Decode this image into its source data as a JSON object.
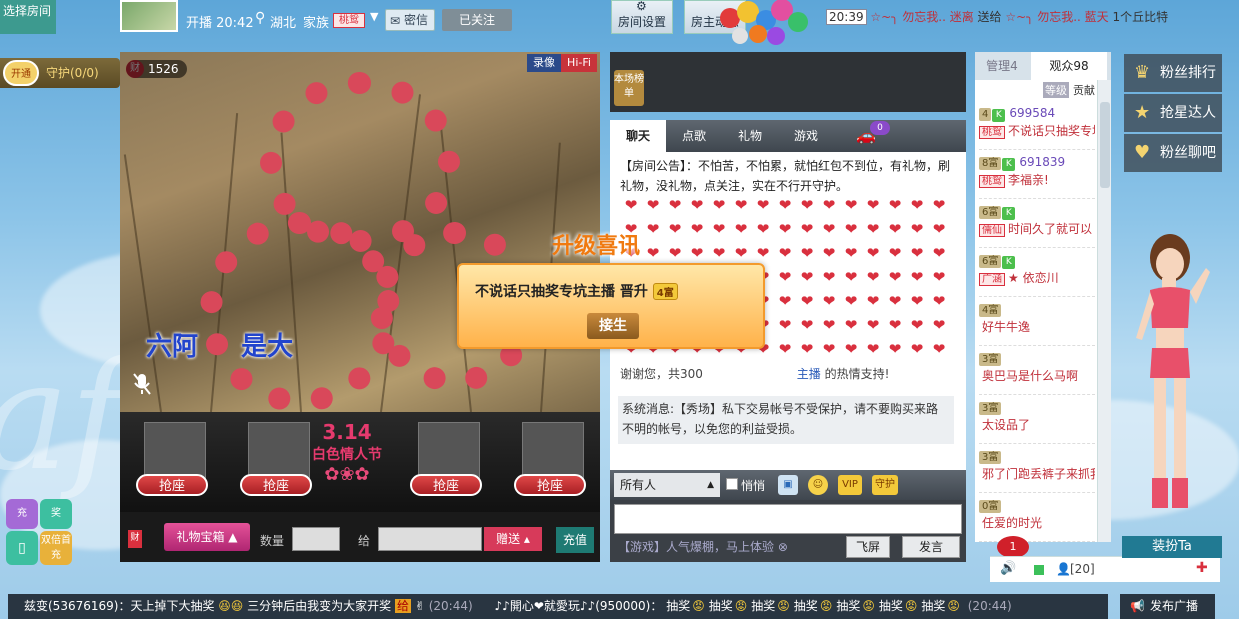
{
  "window": {
    "select_room": "选择房间"
  },
  "anchor": {
    "time_text": "开播 20:42",
    "location": "湖北",
    "family_label": "家族",
    "family_badge": "桃鸳",
    "pm_label": "密信",
    "follow_label": "已关注"
  },
  "tools": {
    "room_settings": "房间设置",
    "anchor_news": "房主动态"
  },
  "ticker_top": {
    "time": "20:39",
    "sender": "☆~╮ 勿忘我.. 迷离",
    "verb": "送给",
    "receiver": "☆~╮ 勿忘我.. 藍天",
    "gift": "1个丘比特"
  },
  "guard": {
    "open_label": "开通",
    "label": "守护(0/0)"
  },
  "video": {
    "wealth": "1526",
    "wealth_icon_text": "财",
    "rec_label": "录像",
    "hifi_label": "Hi-Fi",
    "caption_a": "六阿",
    "caption_b": "是大"
  },
  "seats": {
    "label": "抢座",
    "event_title": "3.14",
    "event_sub": "白色情人节"
  },
  "giftbar": {
    "gift_box": "礼物宝箱",
    "qty_label": "数量",
    "to_label": "给",
    "send_label": "赠送",
    "recharge_label": "充值"
  },
  "rank": {
    "tag": "本场榜单"
  },
  "chat": {
    "tabs": [
      "聊天",
      "点歌",
      "礼物",
      "游戏"
    ],
    "car_count": "0",
    "announce": "【房间公告】：不怕苦，不怕累，就怕红包不到位，有礼物，刷礼物，没礼物，点关注，实在不行开守护。",
    "heart": "❤",
    "thanks_a": "谢谢您，共300",
    "thanks_b": "主播",
    "thanks_c": "的热情支持!",
    "system_msg": "系统消息:【秀场】私下交易帐号不受保护，请不要购买来路不明的帐号，以免您的利益受损。",
    "to_select": "所有人",
    "private_label": "悄悄",
    "vip_label": "VIP",
    "guard_icon_label": "守护",
    "game_line": "【游戏】人气爆棚，马上体验",
    "fly_screen": "飞屏",
    "send_msg": "发言"
  },
  "popup": {
    "title": "升级喜讯",
    "text": "不说话只抽奖专坑主播  晋升",
    "level": "4富",
    "button": "接生"
  },
  "audience": {
    "tab_manage": "管理4",
    "tab_viewers": "观众98",
    "head_level": "等级",
    "head_contrib": "贡献",
    "items": [
      {
        "level": "4",
        "id": "699584",
        "fam": "桃鸳",
        "nick": "不说话只抽奖专坑主播"
      },
      {
        "level": "8富",
        "id": "691839",
        "fam": "桃鸳",
        "nick": "李福亲!"
      },
      {
        "level": "6富",
        "id": "",
        "fam": "儒仙",
        "nick": "时间久了就可以"
      },
      {
        "level": "6富",
        "id": "",
        "fam": "广涵",
        "nick": "★ 依恋川"
      },
      {
        "level": "4富",
        "id": "",
        "fam": "",
        "nick": "好牛牛逸"
      },
      {
        "level": "3富",
        "id": "",
        "fam": "",
        "nick": "奥巴马是什么马啊"
      },
      {
        "level": "3富",
        "id": "",
        "fam": "",
        "nick": "太设品了"
      },
      {
        "level": "3富",
        "id": "",
        "fam": "",
        "nick": "邪了门跑丢裤子来抓我"
      },
      {
        "level": "0富",
        "id": "",
        "fam": "",
        "nick": "任爱的时光"
      }
    ],
    "notify_count": "1",
    "online_count": "[20]"
  },
  "right": {
    "fans_rank": "粉丝排行",
    "star_catcher": "抢星达人",
    "fans_chat": "粉丝聊吧",
    "dress_up": "装扮Ta"
  },
  "quick": {
    "charge": "充",
    "award": "奖",
    "mobile": "双倍首充"
  },
  "bottom_ticker": {
    "a": "兹变(53676169)：天上掉下大抽奖",
    "b": "三分钟后由我变为大家开奖",
    "give": "给",
    "time_a": "(20:44)",
    "c": "♪♪開心❤就愛玩♪♪(950000)：",
    "lottery": "抽奖",
    "time_b": "(20:44)",
    "broadcast": "发布广播"
  },
  "colors": {
    "accent": "#d9303e",
    "teal": "#1e7a73",
    "gold": "#f3c93a"
  }
}
